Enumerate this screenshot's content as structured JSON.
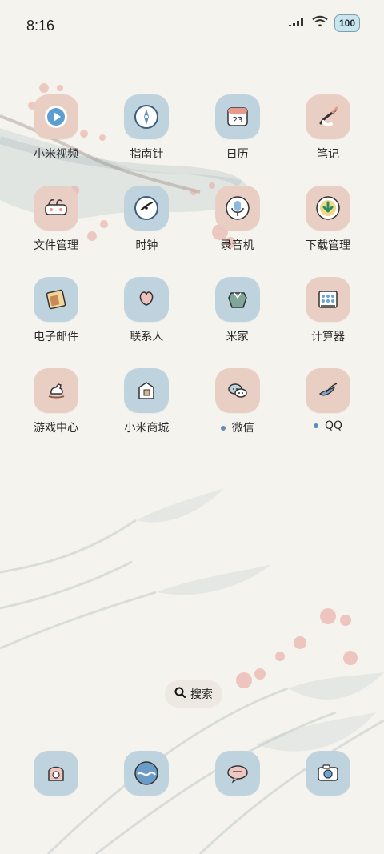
{
  "status": {
    "time": "8:16",
    "battery": "100"
  },
  "apps": [
    [
      {
        "id": "xiaomi-video",
        "label": "小米视频",
        "icon": "play-icon",
        "bg": "pink"
      },
      {
        "id": "compass",
        "label": "指南针",
        "icon": "compass-icon",
        "bg": "blue"
      },
      {
        "id": "calendar",
        "label": "日历",
        "icon": "calendar-icon",
        "bg": "blue",
        "calendar_day": "23"
      },
      {
        "id": "notes",
        "label": "笔记",
        "icon": "notes-icon",
        "bg": "pink"
      }
    ],
    [
      {
        "id": "file-manager",
        "label": "文件管理",
        "icon": "folder-icon",
        "bg": "pink"
      },
      {
        "id": "clock",
        "label": "时钟",
        "icon": "clock-icon",
        "bg": "blue"
      },
      {
        "id": "recorder",
        "label": "录音机",
        "icon": "mic-icon",
        "bg": "pink"
      },
      {
        "id": "download-manager",
        "label": "下载管理",
        "icon": "download-icon",
        "bg": "pink"
      }
    ],
    [
      {
        "id": "email",
        "label": "电子邮件",
        "icon": "mail-icon",
        "bg": "blue"
      },
      {
        "id": "contacts",
        "label": "联系人",
        "icon": "contacts-icon",
        "bg": "blue"
      },
      {
        "id": "mi-home",
        "label": "米家",
        "icon": "home-icon",
        "bg": "blue"
      },
      {
        "id": "calculator",
        "label": "计算器",
        "icon": "calculator-icon",
        "bg": "pink"
      }
    ],
    [
      {
        "id": "game-center",
        "label": "游戏中心",
        "icon": "game-icon",
        "bg": "pink"
      },
      {
        "id": "mi-mall",
        "label": "小米商城",
        "icon": "store-icon",
        "bg": "blue"
      },
      {
        "id": "wechat",
        "label": "微信",
        "icon": "chat-icon",
        "bg": "pink",
        "dot": true
      },
      {
        "id": "qq",
        "label": "QQ",
        "icon": "bird-icon",
        "bg": "pink",
        "dot": true
      }
    ]
  ],
  "search_chip": {
    "label": "搜索"
  },
  "dock": [
    {
      "id": "phone",
      "icon": "phone-icon",
      "bg": "blue"
    },
    {
      "id": "browser",
      "icon": "browser-icon",
      "bg": "blue"
    },
    {
      "id": "messages",
      "icon": "message-icon",
      "bg": "blue"
    },
    {
      "id": "camera",
      "icon": "camera-icon",
      "bg": "blue"
    }
  ],
  "colors": {
    "background": "#f5f3ee",
    "pinkTile": "#e9cfc3",
    "blueTile": "#bfd3df",
    "dot": "#5c8dbb",
    "text": "#2a2a2a"
  }
}
